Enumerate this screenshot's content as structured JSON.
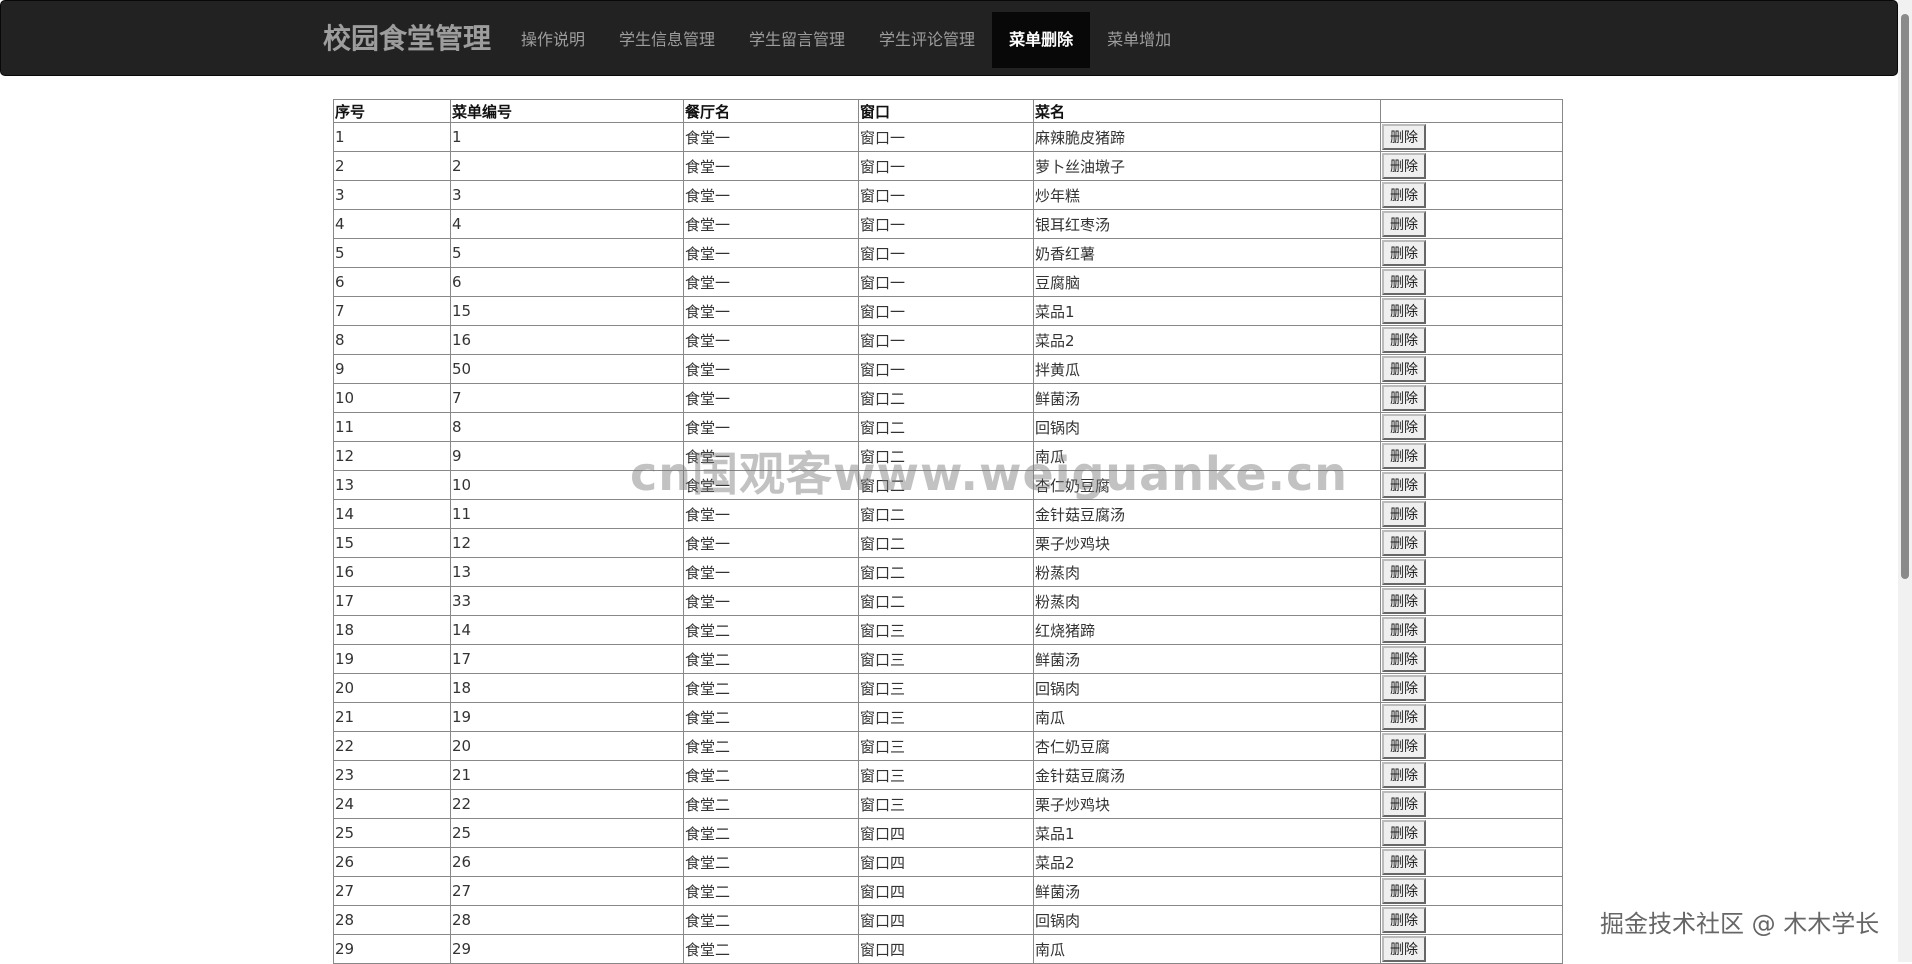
{
  "navbar": {
    "brand": "校园食堂管理",
    "items": [
      {
        "label": "操作说明",
        "active": false
      },
      {
        "label": "学生信息管理",
        "active": false
      },
      {
        "label": "学生留言管理",
        "active": false
      },
      {
        "label": "学生评论管理",
        "active": false
      },
      {
        "label": "菜单删除",
        "active": true
      },
      {
        "label": "菜单增加",
        "active": false
      }
    ]
  },
  "table": {
    "headers": [
      "序号",
      "菜单编号",
      "餐厅名",
      "窗口",
      "菜名",
      ""
    ],
    "button_label": "删除",
    "rows": [
      [
        "1",
        "1",
        "食堂一",
        "窗口一",
        "麻辣脆皮猪蹄"
      ],
      [
        "2",
        "2",
        "食堂一",
        "窗口一",
        "萝卜丝油墩子"
      ],
      [
        "3",
        "3",
        "食堂一",
        "窗口一",
        "炒年糕"
      ],
      [
        "4",
        "4",
        "食堂一",
        "窗口一",
        "银耳红枣汤"
      ],
      [
        "5",
        "5",
        "食堂一",
        "窗口一",
        "奶香红薯"
      ],
      [
        "6",
        "6",
        "食堂一",
        "窗口一",
        "豆腐脑"
      ],
      [
        "7",
        "15",
        "食堂一",
        "窗口一",
        "菜品1"
      ],
      [
        "8",
        "16",
        "食堂一",
        "窗口一",
        "菜品2"
      ],
      [
        "9",
        "50",
        "食堂一",
        "窗口一",
        "拌黄瓜"
      ],
      [
        "10",
        "7",
        "食堂一",
        "窗口二",
        "鲜菌汤"
      ],
      [
        "11",
        "8",
        "食堂一",
        "窗口二",
        "回锅肉"
      ],
      [
        "12",
        "9",
        "食堂一",
        "窗口二",
        "南瓜"
      ],
      [
        "13",
        "10",
        "食堂一",
        "窗口二",
        "杏仁奶豆腐"
      ],
      [
        "14",
        "11",
        "食堂一",
        "窗口二",
        "金针菇豆腐汤"
      ],
      [
        "15",
        "12",
        "食堂一",
        "窗口二",
        "栗子炒鸡块"
      ],
      [
        "16",
        "13",
        "食堂一",
        "窗口二",
        "粉蒸肉"
      ],
      [
        "17",
        "33",
        "食堂一",
        "窗口二",
        "粉蒸肉"
      ],
      [
        "18",
        "14",
        "食堂二",
        "窗口三",
        "红烧猪蹄"
      ],
      [
        "19",
        "17",
        "食堂二",
        "窗口三",
        "鲜菌汤"
      ],
      [
        "20",
        "18",
        "食堂二",
        "窗口三",
        "回锅肉"
      ],
      [
        "21",
        "19",
        "食堂二",
        "窗口三",
        "南瓜"
      ],
      [
        "22",
        "20",
        "食堂二",
        "窗口三",
        "杏仁奶豆腐"
      ],
      [
        "23",
        "21",
        "食堂二",
        "窗口三",
        "金针菇豆腐汤"
      ],
      [
        "24",
        "22",
        "食堂二",
        "窗口三",
        "栗子炒鸡块"
      ],
      [
        "25",
        "25",
        "食堂二",
        "窗口四",
        "菜品1"
      ],
      [
        "26",
        "26",
        "食堂二",
        "窗口四",
        "菜品2"
      ],
      [
        "27",
        "27",
        "食堂二",
        "窗口四",
        "鲜菌汤"
      ],
      [
        "28",
        "28",
        "食堂二",
        "窗口四",
        "回锅肉"
      ],
      [
        "29",
        "29",
        "食堂二",
        "窗口四",
        "南瓜"
      ]
    ]
  },
  "watermark": "cn国观客www.weiguanke.cn",
  "credit": "掘金技术社区 @ 木木学长"
}
